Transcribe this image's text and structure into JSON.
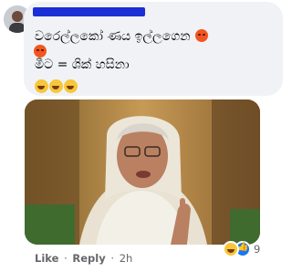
{
  "comment": {
    "line1_text": "වරෙල්ලකෝ ණය ඉල්ලගෙන",
    "line2_text": "මීට = ශික් හසිනා",
    "emojis_line1": [
      "angry-face-icon",
      "angry-face-icon"
    ],
    "emojis_line3": [
      "laughing-face-icon",
      "laughing-face-icon",
      "laughing-face-icon"
    ]
  },
  "actions": {
    "like_label": "Like",
    "dot1": "·",
    "reply_label": "Reply",
    "dot2": "·",
    "time": "2h"
  },
  "reactions": {
    "icons": [
      "haha-reaction-icon",
      "like-reaction-icon"
    ],
    "count": "9"
  },
  "colors": {
    "bubble_bg": "#f0f2f5",
    "name_redaction": "#1a2fd6",
    "meta_text": "#65676b",
    "like_blue": "#1877f2"
  }
}
